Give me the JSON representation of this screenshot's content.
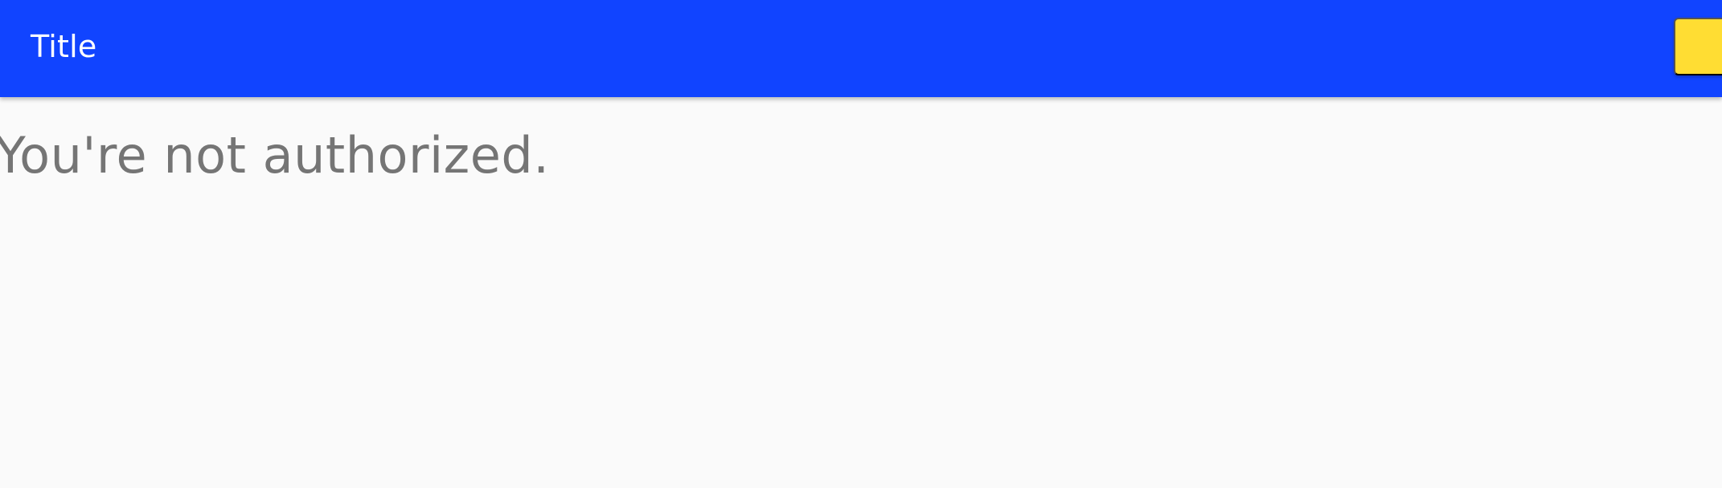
{
  "header": {
    "title": "Title",
    "add_button_label": "+ "
  },
  "main": {
    "message": "You're not authorized."
  },
  "colors": {
    "header_background": "#1144ff",
    "accent_button": "#ffdd33",
    "page_background": "#fafafa",
    "message_text": "#757575"
  }
}
